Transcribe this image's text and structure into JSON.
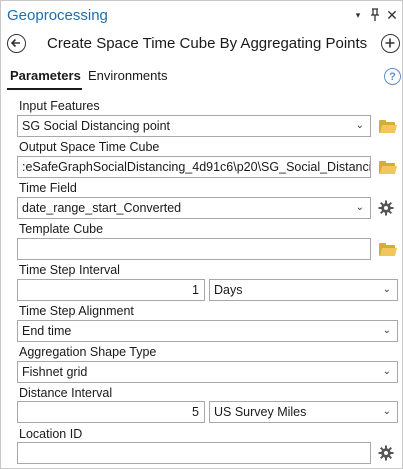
{
  "pane": {
    "title": "Geoprocessing",
    "menu_glyph": "▾",
    "pin_glyph": "ᵖ",
    "close_glyph": "✕"
  },
  "tool": {
    "title": "Create Space Time Cube By Aggregating Points",
    "back_icon": "back-arrow-icon",
    "add_icon": "add-icon"
  },
  "tabs": [
    {
      "label": "Parameters",
      "active": true
    },
    {
      "label": "Environments",
      "active": false
    }
  ],
  "help_glyph": "?",
  "params": {
    "input_features": {
      "label": "Input Features",
      "value": "SG Social Distancing point"
    },
    "output_cube": {
      "label": "Output Space Time Cube",
      "value": ":eSafeGraphSocialDistancing_4d91c6\\p20\\SG_Social_Distancing.nc"
    },
    "time_field": {
      "label": "Time Field",
      "value": "date_range_start_Converted"
    },
    "template_cube": {
      "label": "Template Cube",
      "value": ""
    },
    "time_step_interval": {
      "label": "Time Step Interval",
      "value": "1",
      "unit": "Days"
    },
    "time_step_alignment": {
      "label": "Time Step Alignment",
      "value": "End time"
    },
    "aggregation_shape": {
      "label": "Aggregation Shape Type",
      "value": "Fishnet grid"
    },
    "distance_interval": {
      "label": "Distance Interval",
      "value": "5",
      "unit": "US Survey Miles"
    },
    "location_id": {
      "label": "Location ID",
      "value": ""
    }
  },
  "colors": {
    "accent": "#1a6fb3",
    "folder": "#d9a93a",
    "help": "#5b8fcf"
  }
}
